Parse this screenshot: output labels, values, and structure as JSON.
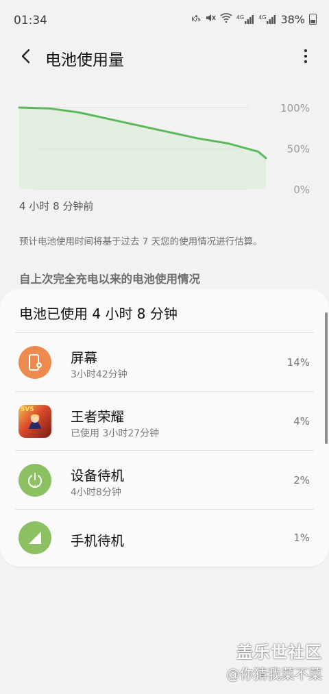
{
  "status_bar": {
    "time": "01:34",
    "speed_indicator": "K/s",
    "signal_4g_1": "4G",
    "signal_4g_2": "4G",
    "battery_percent": "38%"
  },
  "header": {
    "title": "电池使用量"
  },
  "chart_data": {
    "type": "area",
    "x": [
      0.0,
      0.5,
      1.0,
      1.5,
      2.0,
      2.5,
      3.0,
      3.5,
      4.0,
      4.13
    ],
    "y": [
      100,
      99,
      94,
      86,
      78,
      70,
      62,
      56,
      46,
      38
    ],
    "ylim": [
      0,
      100
    ],
    "ytick_labels": [
      "100%",
      "50%",
      "0%"
    ],
    "grid": true,
    "line_color": "#5cb85c",
    "fill_color": "#dfeedd"
  },
  "chart_caption": "4 小时 8 分钟前",
  "estimate_note": "预计电池使用时间将基于过去 7 天您的使用情况进行估算。",
  "section_title": "自上次完全充电以来的电池使用情况",
  "usage_card": {
    "header": "电池已使用 4 小时 8 分钟",
    "items": [
      {
        "name": "屏幕",
        "sub": "3小时42分钟",
        "percent": "14%",
        "icon": "screen-settings-icon",
        "color": "#ef8a4f"
      },
      {
        "name": "王者荣耀",
        "sub": "已使用 3小时27分钟",
        "percent": "4%",
        "icon": "game-app-icon",
        "color": "#c23b2b",
        "badge": "5V5"
      },
      {
        "name": "设备待机",
        "sub": "4小时8分钟",
        "percent": "2%",
        "icon": "power-standby-icon",
        "color": "#8cc063"
      },
      {
        "name": "手机待机",
        "sub": "",
        "percent": "1%",
        "icon": "cell-signal-icon",
        "color": "#8cc063"
      }
    ]
  },
  "watermark": {
    "line1": "盖乐世社区",
    "line2": "@你猜我菜不菜"
  }
}
